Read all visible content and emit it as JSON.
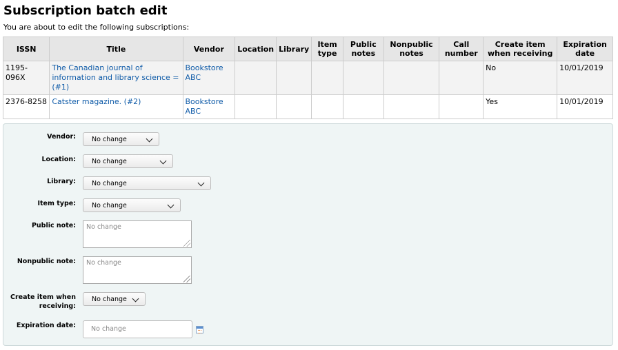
{
  "page": {
    "title": "Subscription batch edit",
    "intro": "You are about to edit the following subscriptions:"
  },
  "table": {
    "headers": {
      "issn": "ISSN",
      "title": "Title",
      "vendor": "Vendor",
      "location": "Location",
      "library": "Library",
      "item_type": "Item type",
      "public_notes": "Public notes",
      "nonpublic_notes": "Nonpublic notes",
      "call_number": "Call number",
      "create_item": "Create item when receiving",
      "expiration": "Expiration date"
    },
    "rows": [
      {
        "issn": "1195-096X",
        "title": "The Canadian journal of information and library science = (#1)",
        "vendor": "Bookstore ABC",
        "location": "",
        "library": "",
        "item_type": "",
        "public_notes": "",
        "nonpublic_notes": "",
        "call_number": "",
        "create_item": "No",
        "expiration": "10/01/2019"
      },
      {
        "issn": "2376-8258",
        "title": "Catster magazine. (#2)",
        "vendor": "Bookstore ABC",
        "location": "",
        "library": "",
        "item_type": "",
        "public_notes": "",
        "nonpublic_notes": "",
        "call_number": "",
        "create_item": "Yes",
        "expiration": "10/01/2019"
      }
    ]
  },
  "form": {
    "vendor": {
      "label": "Vendor:",
      "value": "No change"
    },
    "location": {
      "label": "Location:",
      "value": "No change"
    },
    "library": {
      "label": "Library:",
      "value": "No change"
    },
    "item_type": {
      "label": "Item type:",
      "value": "No change"
    },
    "public_note": {
      "label": "Public note:",
      "placeholder": "No change"
    },
    "nonpublic_note": {
      "label": "Nonpublic note:",
      "placeholder": "No change"
    },
    "create_item": {
      "label_line1": "Create item when",
      "label_line2": "receiving:",
      "value": "No change"
    },
    "expiration": {
      "label": "Expiration date:",
      "placeholder": "No change"
    }
  },
  "icons": {
    "date_picker": "calendar-icon",
    "dropdown": "chevron-down-icon",
    "resize": "resize-grip-icon"
  },
  "colors": {
    "link": "#0f5ba8",
    "panel_bg": "#eff5f5",
    "header_bg": "#e6e6e6"
  }
}
